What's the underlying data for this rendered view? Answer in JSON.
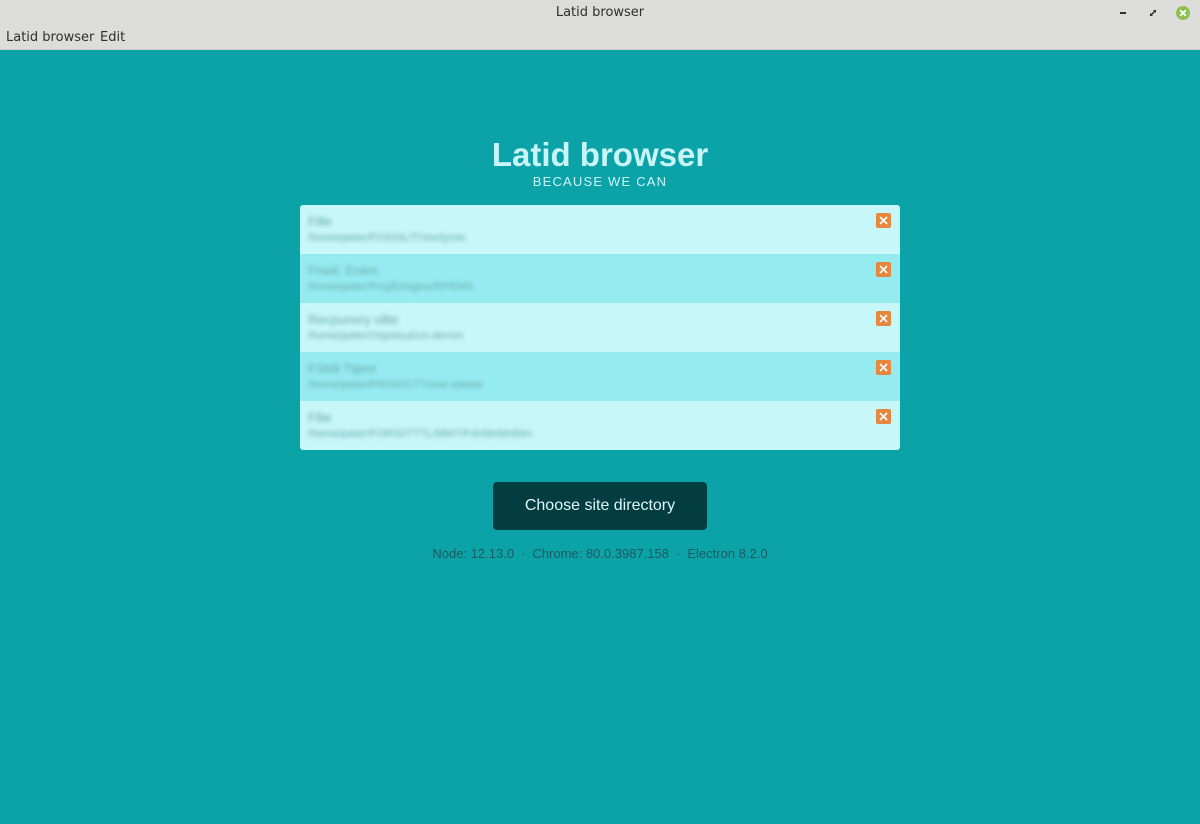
{
  "window": {
    "title": "Latid browser"
  },
  "menu": [
    "Latid browser",
    "Edit"
  ],
  "app": {
    "title": "Latid browser",
    "tagline": "BECAUSE WE CAN"
  },
  "sites": [
    {
      "name": "Fille",
      "path": "/home/peter/FOSSIL/T/Vocfy/vlo"
    },
    {
      "name": "Fnwil. Eniim",
      "path": "/home/peter/Proj/Eimgins/RPEMS"
    },
    {
      "name": "Recpunory ollte",
      "path": "/home/peter/Ospsiout/un-dernm"
    },
    {
      "name": "FStiill Ttjere",
      "path": "/home/peter/PROG/CTT/one-sitesie"
    },
    {
      "name": "Fllie",
      "path": "/home/peter/FORSI/TTTL/MMT/Fdnfdnfdnfdm"
    }
  ],
  "actions": {
    "choose_label": "Choose site directory"
  },
  "versions": {
    "node": "Node: 12.13.0",
    "chrome": "Chrome: 80.0.3987.158",
    "electron": "Electron 8.2.0",
    "separator": "·"
  },
  "colors": {
    "background": "#0ba2a8",
    "row_light": "#c8f7f9",
    "row_dark": "#95ecf0",
    "remove": "#e7873e",
    "button": "#033d42",
    "close_window": "#8cc152"
  }
}
